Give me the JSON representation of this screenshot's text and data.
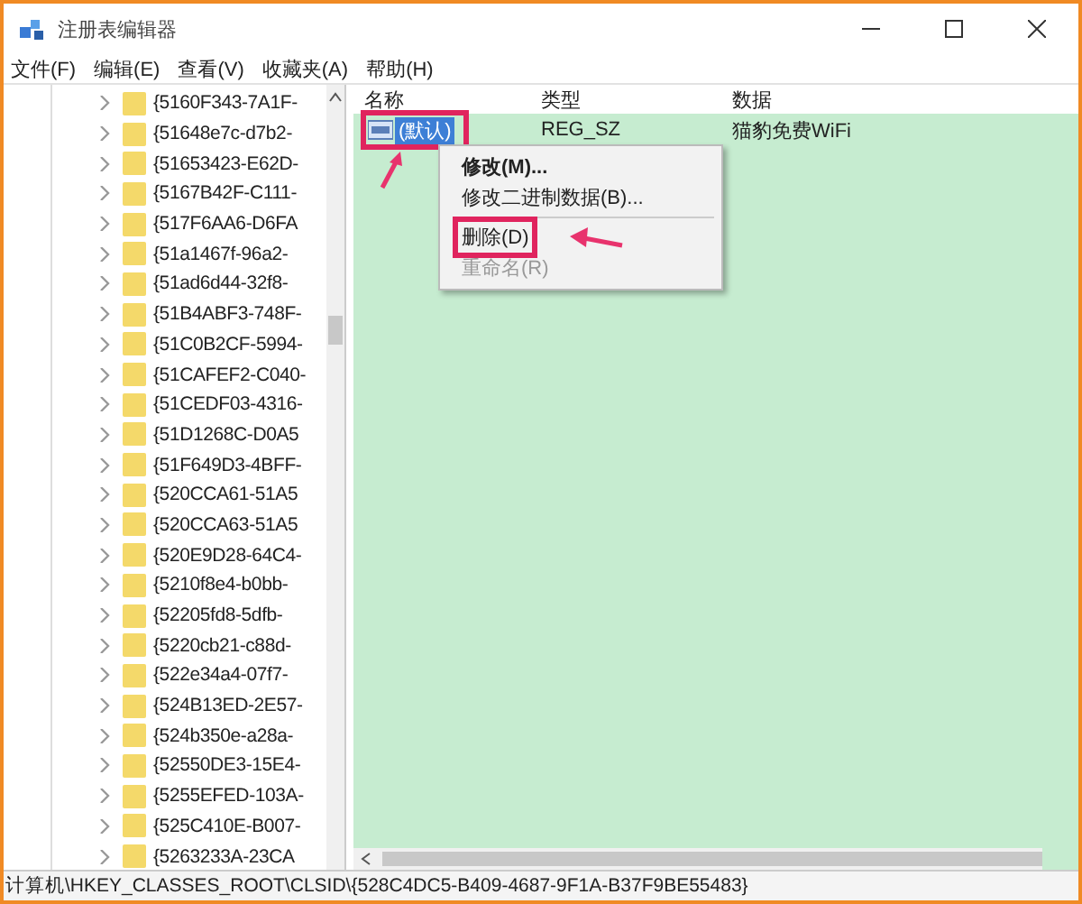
{
  "window": {
    "title": "注册表编辑器"
  },
  "menu": [
    "文件(F)",
    "编辑(E)",
    "查看(V)",
    "收藏夹(A)",
    "帮助(H)"
  ],
  "tree": {
    "items": [
      {
        "label": "{5160F343-7A1F-",
        "expanded": false
      },
      {
        "label": "{51648e7c-d7b2-",
        "expanded": false
      },
      {
        "label": "{51653423-E62D-",
        "expanded": false
      },
      {
        "label": "{5167B42F-C111-",
        "expanded": false
      },
      {
        "label": "{517F6AA6-D6FA",
        "expanded": false
      },
      {
        "label": "{51a1467f-96a2-",
        "expanded": false
      },
      {
        "label": "{51ad6d44-32f8-",
        "expanded": false
      },
      {
        "label": "{51B4ABF3-748F-",
        "expanded": false
      },
      {
        "label": "{51C0B2CF-5994-",
        "expanded": false
      },
      {
        "label": "{51CAFEF2-C040-",
        "expanded": false
      },
      {
        "label": "{51CEDF03-4316-",
        "expanded": false
      },
      {
        "label": "{51D1268C-D0A5",
        "expanded": false
      },
      {
        "label": "{51F649D3-4BFF-",
        "expanded": false
      },
      {
        "label": "{520CCA61-51A5",
        "expanded": false
      },
      {
        "label": "{520CCA63-51A5",
        "expanded": false
      },
      {
        "label": "{520E9D28-64C4-",
        "expanded": false
      },
      {
        "label": "{5210f8e4-b0bb-",
        "expanded": false
      },
      {
        "label": "{52205fd8-5dfb-",
        "expanded": false
      },
      {
        "label": "{5220cb21-c88d-",
        "expanded": false
      },
      {
        "label": "{522e34a4-07f7-",
        "expanded": false
      },
      {
        "label": "{524B13ED-2E57-",
        "expanded": false
      },
      {
        "label": "{524b350e-a28a-",
        "expanded": false
      },
      {
        "label": "{52550DE3-15E4-",
        "expanded": false
      },
      {
        "label": "{5255EFED-103A-",
        "expanded": false
      },
      {
        "label": "{525C410E-B007-",
        "expanded": false
      },
      {
        "label": "{5263233A-23CA",
        "expanded": false
      }
    ]
  },
  "values": {
    "columns": [
      "名称",
      "类型",
      "数据"
    ],
    "rows": [
      {
        "name": "(默认)",
        "type": "REG_SZ",
        "data": "猫豹免费WiFi",
        "selected": true,
        "highlighted": true
      }
    ]
  },
  "context_menu": {
    "items": [
      {
        "kind": "item",
        "label": "修改(M)...",
        "bold": true,
        "disabled": false,
        "highlighted": false
      },
      {
        "kind": "item",
        "label": "修改二进制数据(B)...",
        "bold": false,
        "disabled": false,
        "highlighted": false
      },
      {
        "kind": "separator"
      },
      {
        "kind": "item",
        "label": "删除(D)",
        "bold": false,
        "disabled": false,
        "highlighted": true
      },
      {
        "kind": "item",
        "label": "重命名(R)",
        "bold": false,
        "disabled": true,
        "highlighted": false
      }
    ]
  },
  "status_bar": "计算机\\HKEY_CLASSES_ROOT\\CLSID\\{528C4DC5-B409-4687-9F1A-B37F9BE55483}"
}
